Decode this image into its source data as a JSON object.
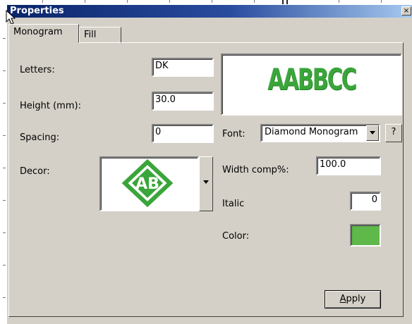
{
  "window": {
    "title": "Properties",
    "close_glyph": "×"
  },
  "tabs": [
    {
      "label": "Monogram",
      "active": true
    },
    {
      "label": "Fill",
      "active": false
    }
  ],
  "fields": {
    "letters_label": "Letters:",
    "letters_value": "DK",
    "height_label": "Height (mm):",
    "height_value": "30.0",
    "spacing_label": "Spacing:",
    "spacing_value": "0",
    "decor_label": "Decor:",
    "font_label": "Font:",
    "font_value": "Diamond Monogram",
    "help_label": "?",
    "width_label": "Width comp%:",
    "width_value": "100.0",
    "italic_label": "Italic",
    "italic_value": "0",
    "color_label": "Color:"
  },
  "preview": {
    "sample_text": "AABBCC",
    "decor_text": "AB"
  },
  "colors": {
    "monogram_green": "#3aa53a",
    "swatch_color": "#5fb84a"
  },
  "buttons": {
    "apply_prefix": "",
    "apply_underlined": "A",
    "apply_rest": "pply"
  },
  "icons": {
    "cursor": "mouse-pointer-icon",
    "dropdown": "chevron-down-icon"
  }
}
